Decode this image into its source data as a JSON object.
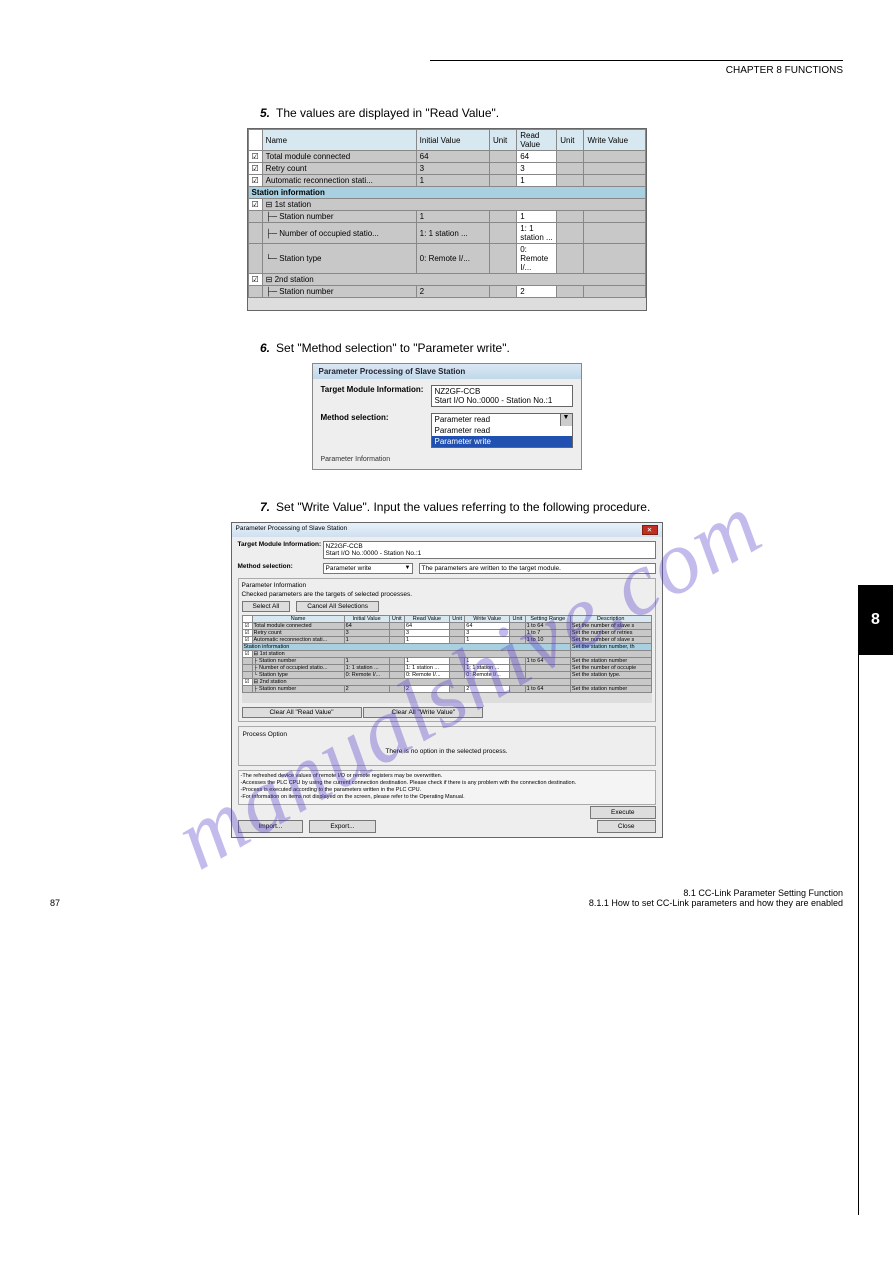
{
  "header": {
    "chapter": "CHAPTER 8 FUNCTIONS",
    "sub": "8.1 CC-Link Parameter Setting Function"
  },
  "black_tab": "8",
  "steps": {
    "s5": "The values are displayed in \"Read Value\".",
    "s6": "Set \"Method selection\" to \"Parameter write\".",
    "s7": "Set \"Write Value\". Input the values referring to the following procedure."
  },
  "fig1": {
    "headers": [
      "",
      "Name",
      "Initial Value",
      "Unit",
      "Read Value",
      "Unit",
      "Write Value"
    ],
    "rows": [
      {
        "chk": "☑",
        "name": "Total module connected",
        "iv": "64",
        "rv": "64"
      },
      {
        "chk": "☑",
        "name": "Retry count",
        "iv": "3",
        "rv": "3"
      },
      {
        "chk": "☑",
        "name": "Automatic reconnection stati...",
        "iv": "1",
        "rv": "1"
      }
    ],
    "section": "Station information",
    "station1": {
      "chk": "☑",
      "name": "1st station",
      "rows": [
        {
          "name": "Station number",
          "iv": "1",
          "rv": "1"
        },
        {
          "name": "Number of occupied statio...",
          "iv": "1: 1 station ...",
          "rv": "1: 1 station ..."
        },
        {
          "name": "Station type",
          "iv": "0: Remote I/...",
          "rv": "0: Remote I/..."
        }
      ]
    },
    "station2": {
      "chk": "☑",
      "name": "2nd station",
      "rows": [
        {
          "name": "Station number",
          "iv": "2",
          "rv": "2"
        }
      ]
    }
  },
  "fig2": {
    "title": "Parameter Processing of Slave Station",
    "target_label": "Target Module Information:",
    "target_value": "NZ2GF-CCB\nStart I/O No.:0000 - Station No.:1",
    "method_label": "Method selection:",
    "dropdown_selected": "Parameter read",
    "dropdown_options": [
      "Parameter read",
      "Parameter write"
    ],
    "param_info": "Parameter Information"
  },
  "fig3": {
    "title": "Parameter Processing of Slave Station",
    "close": "✕",
    "target_label": "Target Module Information:",
    "target_value": "NZ2GF-CCB\nStart I/O No.:0000 - Station No.:1",
    "method_label": "Method selection:",
    "method_value": "Parameter write",
    "method_desc": "The parameters are written to the target module.",
    "group_title": "Parameter Information",
    "group_sub": "Checked parameters are the targets of selected processes.",
    "select_all": "Select All",
    "cancel_all": "Cancel All Selections",
    "headers": [
      "",
      "Name",
      "Initial Value",
      "Unit",
      "Read Value",
      "Unit",
      "Write Value",
      "Unit",
      "Setting Range",
      "Description"
    ],
    "rows": [
      {
        "chk": "☑",
        "name": "Total module connected",
        "iv": "64",
        "rv": "64",
        "wv": "64",
        "range": "1 to 64",
        "desc": "Set the number of slave s"
      },
      {
        "chk": "☑",
        "name": "Retry count",
        "iv": "3",
        "rv": "3",
        "wv": "3",
        "range": "1 to 7",
        "desc": "Set the number of retries"
      },
      {
        "chk": "☑",
        "name": "Automatic reconnection stati...",
        "iv": "1",
        "rv": "1",
        "wv": "1",
        "range": "1 to 10",
        "desc": "Set the number of slave s"
      }
    ],
    "section": "Station information",
    "section_desc": "Set the station number, th",
    "st1": {
      "chk": "☑",
      "name": "1st station",
      "rows": [
        {
          "name": "Station number",
          "iv": "1",
          "rv": "1",
          "wv": "1",
          "range": "1 to 64",
          "desc": "Set the station number"
        },
        {
          "name": "Number of occupied statio...",
          "iv": "1: 1 station ...",
          "rv": "1: 1 station ...",
          "wv": "1: 1 station ...",
          "desc": "Set the number of occupie"
        },
        {
          "name": "Station type",
          "iv": "0: Remote I/...",
          "rv": "0: Remote I/...",
          "wv": "0: Remote I/...",
          "desc": "Set the station type."
        }
      ]
    },
    "st2": {
      "chk": "☑",
      "name": "2nd station",
      "rows": [
        {
          "name": "Station number",
          "iv": "2",
          "rv": "2",
          "wv": "2",
          "range": "1 to 64",
          "desc": "Set the station number"
        }
      ]
    },
    "clear_read": "Clear All \"Read Value\"",
    "clear_write": "Clear All \"Write Value\"",
    "process_option": "Process Option",
    "process_text": "There is no option in the selected process.",
    "notes": "-The refreshed device values of remote I/O or remote registers may be overwritten.\n-Accesses the PLC CPU by using the current connection destination. Please check if there is any problem with the connection destination.\n-Process is executed according to the parameters written in the PLC CPU.\n-For information on items not displayed on the screen, please refer to the Operating Manual.",
    "execute": "Execute",
    "import": "Import...",
    "export": "Export...",
    "close_btn": "Close"
  },
  "footer": {
    "page": "87",
    "right_top": "8.1 CC-Link Parameter Setting Function",
    "right_bot": "8.1.1 How to set CC-Link parameters and how they are enabled"
  }
}
